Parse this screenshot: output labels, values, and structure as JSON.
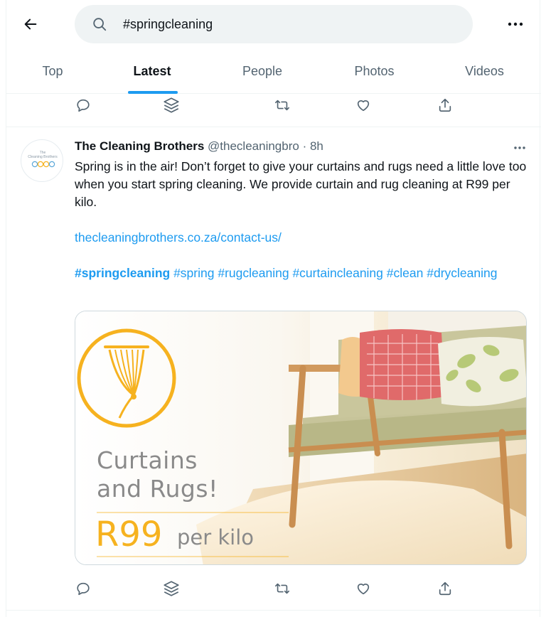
{
  "search": {
    "query": "#springcleaning"
  },
  "tabs": [
    {
      "label": "Top"
    },
    {
      "label": "Latest"
    },
    {
      "label": "People"
    },
    {
      "label": "Photos"
    },
    {
      "label": "Videos"
    }
  ],
  "active_tab": "Latest",
  "tweet": {
    "author_name": "The Cleaning Brothers",
    "handle": "@thecleaningbro",
    "time": "8h",
    "text": "Spring is in the air! Don’t forget to give your curtains and rugs need a little love too when you start spring cleaning. We provide curtain and rug cleaning at R99 per kilo.",
    "link": "thecleaningbrothers.co.za/contact-us/",
    "hashtags": [
      "#springcleaning",
      "#spring",
      "#rugcleaning",
      "#curtaincleaning",
      "#clean",
      "#drycleaning"
    ],
    "media": {
      "title_line1": "Curtains",
      "title_line2": "and Rugs!",
      "price": "R99",
      "unit": "per kilo"
    },
    "avatar_logo_text": "Cleaning Brothers"
  },
  "icons": {
    "back": "arrow-left-icon",
    "search": "search-icon",
    "more": "more-horizontal-icon",
    "reply": "reply-icon",
    "stack": "stack-icon",
    "retweet": "retweet-icon",
    "like": "heart-icon",
    "share": "share-icon"
  },
  "colors": {
    "accent": "#1d9bf0",
    "text": "#0f1419",
    "secondary": "#536471",
    "brand_yellow": "#f6b21f"
  }
}
